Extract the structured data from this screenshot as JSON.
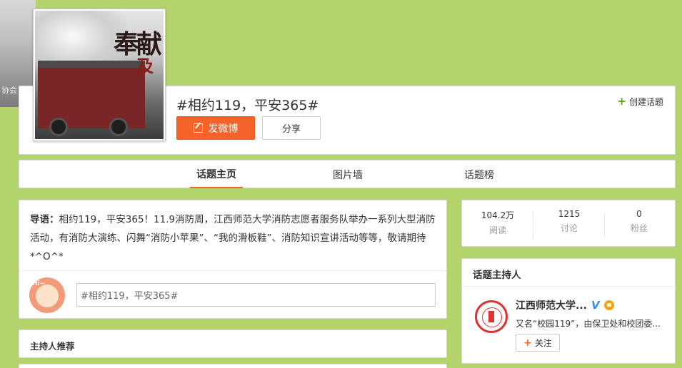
{
  "topic": {
    "title": "#相约119，平安365#",
    "post_button": "发微博",
    "share_button": "分享",
    "create_topic": "创建话题",
    "avatar_calligraphy_1": "奉献",
    "avatar_calligraphy_2": "及"
  },
  "background": {
    "text": "协会"
  },
  "tabs": [
    {
      "label": "话题主页",
      "active": true
    },
    {
      "label": "图片墙",
      "active": false
    },
    {
      "label": "话题榜",
      "active": false
    }
  ],
  "intro": {
    "lead": "导语：",
    "text": "相约119，平安365！11.9消防周，江西师范大学消防志愿者服务队举办一系列大型消防活动，有消防大演练、闪舞“消防小苹果”、“我的滑板鞋”、消防知识宣讲活动等等，敬请期待*^O^*",
    "input_value": "#相约119，平安365#",
    "avatar_text": "Hi~"
  },
  "host_recommend": {
    "title": "主持人推荐"
  },
  "stats": [
    {
      "value": "104.2万",
      "label": "阅读"
    },
    {
      "value": "1215",
      "label": "讨论"
    },
    {
      "value": "0",
      "label": "粉丝"
    }
  ],
  "host": {
    "section_title": "话题主持人",
    "name": "江西师范大学...",
    "verified_mark": "V",
    "description": "又名“校园119”，由保卫处和校团委...",
    "follow_button": "关注"
  },
  "colors": {
    "background": "#b3d46c",
    "accent_orange": "#f5632a",
    "plus_green": "#5ea21c"
  }
}
